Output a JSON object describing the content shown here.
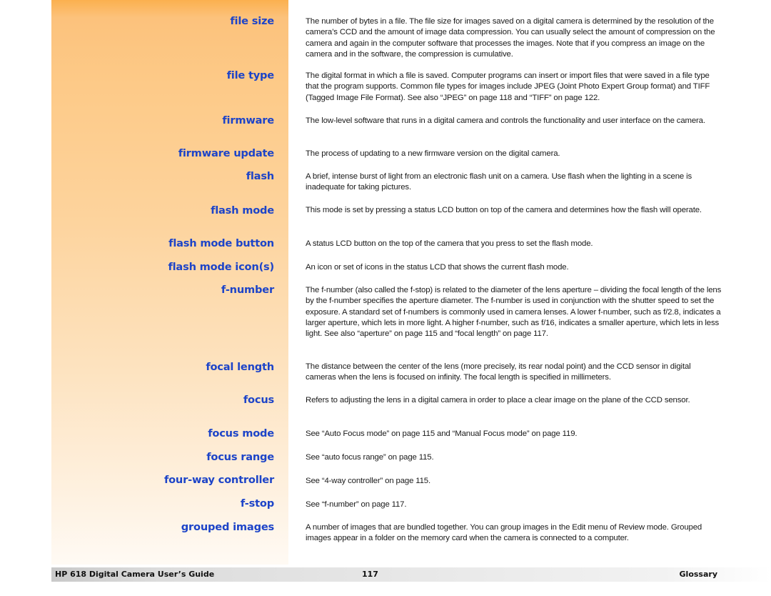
{
  "glossary": {
    "entries": [
      {
        "term": "file size",
        "definition": "The number of bytes in a file. The file size for images saved on a digital camera is determined by the resolution of the camera’s CCD and the amount of image data compression. You can usually select the amount of compression on the camera and again in the computer software that processes the images. Note that if you compress an image on the camera and in the software, the compression is cumulative."
      },
      {
        "term": "file type",
        "definition": "The digital format in which a file is saved. Computer programs can insert or import files that were saved in a file type that the program supports. Common file types for images include JPEG (Joint Photo Expert Group format) and TIFF (Tagged Image File Format). See also “JPEG” on page 118 and “TIFF” on page 122."
      },
      {
        "term": "firmware",
        "definition": "The low-level software that runs in a digital camera and controls the functionality and user interface on the camera."
      },
      {
        "term": "firmware update",
        "definition": "The process of updating to a new firmware version on the digital camera."
      },
      {
        "term": "flash",
        "definition": "A brief, intense burst of light from an electronic flash unit on a camera. Use flash when the lighting in a scene is inadequate for taking pictures."
      },
      {
        "term": "flash mode",
        "definition": "This mode is set by pressing a status LCD button on top of the camera and determines how the flash will operate."
      },
      {
        "term": "flash mode button",
        "definition": "A status LCD button on the top of the camera that you press to set the flash mode."
      },
      {
        "term": "flash mode icon(s)",
        "definition": "An icon or set of icons in the status LCD that shows the current flash mode."
      },
      {
        "term": "f-number",
        "definition": "The f-number (also called the f-stop) is related to the diameter of the lens aperture – dividing the focal length of the lens by the f-number specifies the aperture diameter. The f-number is used in conjunction with the shutter speed to set the exposure. A standard set of f-numbers is commonly used in camera lenses. A lower f-number, such as f/2.8, indicates a larger aperture, which lets in more light. A higher f-number, such as f/16, indicates a smaller aperture, which lets in less light. See also “aperture” on page 115 and “focal length” on page 117."
      },
      {
        "term": "focal length",
        "definition": "The distance between the center of the lens (more precisely, its rear nodal point) and the CCD sensor in digital cameras when the lens is focused on infinity. The focal length is specified in millimeters."
      },
      {
        "term": "focus",
        "definition": "Refers to adjusting the lens in a digital camera in order to place a clear image on the plane of the CCD sensor."
      },
      {
        "term": "focus mode",
        "definition": "See “Auto Focus mode” on page 115 and “Manual Focus mode” on page 119."
      },
      {
        "term": "focus range",
        "definition": "See “auto focus range” on page 115."
      },
      {
        "term": "four-way controller",
        "definition": "See “4-way controller” on page 115."
      },
      {
        "term": "f-stop",
        "definition": "See “f-number” on page 117."
      },
      {
        "term": "grouped images",
        "definition": "A number of images that are bundled together. You can group images in the Edit menu of Review mode. Grouped images appear in a folder on the memory card when the camera is connected to a computer."
      }
    ]
  },
  "footer": {
    "title": "HP 618 Digital Camera User’s Guide",
    "page_number": "117",
    "section": "Glossary"
  },
  "colors": {
    "term": "#1d44c8",
    "sidebar_top": "#fbb04f",
    "body_text": "#1a1a1a"
  }
}
